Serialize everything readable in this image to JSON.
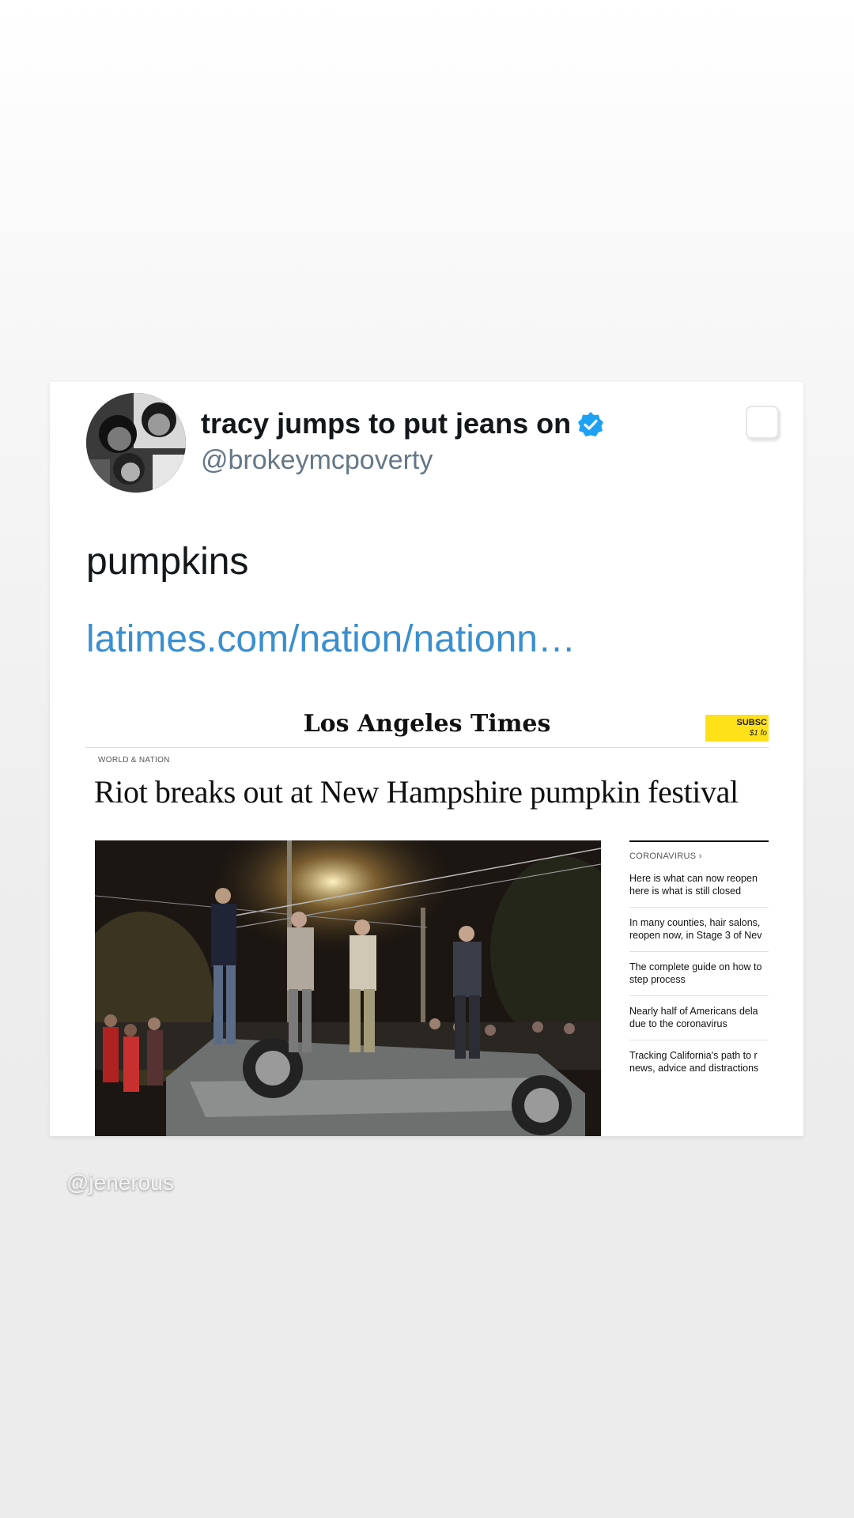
{
  "tweet": {
    "display_name": "tracy jumps to put jeans on",
    "handle": "@brokeymcpoverty",
    "text": "pumpkins",
    "link": "latimes.com/nation/nationn…",
    "verified_color": "#1da1f2",
    "link_color": "#3a8fd0"
  },
  "article": {
    "masthead": "Los Angeles Times",
    "subscribe_line1": "SUBSC",
    "subscribe_line2": "$1 fo",
    "section": "WORLD & NATION",
    "headline": "Riot breaks out at New Hampshire pumpkin festival",
    "sidebar_heading": "CORONAVIRUS ›",
    "sidebar_items": [
      {
        "line1": "Here is what can now reopen",
        "line2": "here is what is still closed"
      },
      {
        "line1": "In many counties, hair salons,",
        "line2": "reopen now, in Stage 3 of Nev"
      },
      {
        "line1": "The complete guide on how to",
        "line2": "step process"
      },
      {
        "line1": "Nearly half of Americans dela",
        "line2": "due to the coronavirus"
      },
      {
        "line1": "Tracking California's path to r",
        "line2": "news, advice and distractions"
      }
    ]
  },
  "story": {
    "mention": "@jenerous"
  }
}
